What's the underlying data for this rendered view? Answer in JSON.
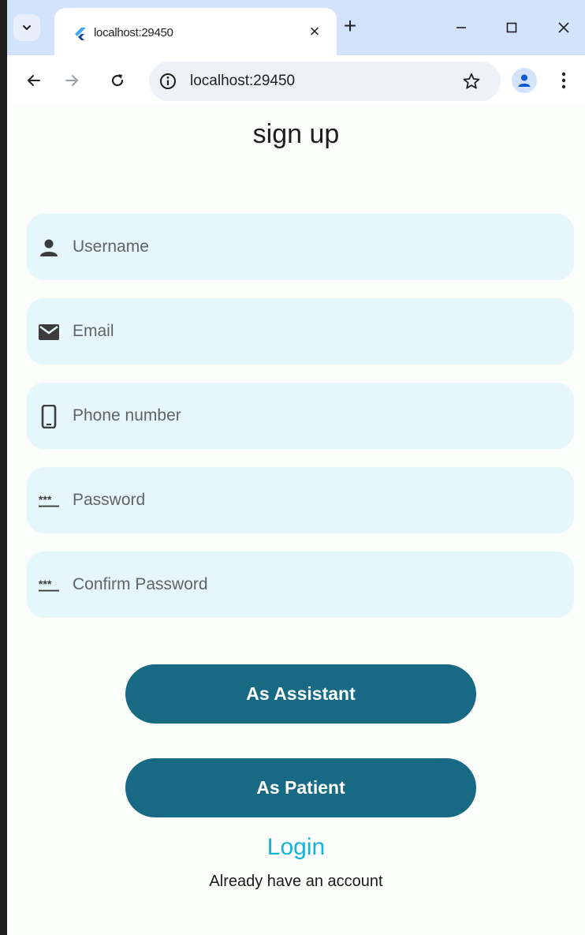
{
  "browser": {
    "tab_title": "localhost:29450",
    "url": "localhost:29450",
    "tab_close_glyph": "×",
    "new_tab_glyph": "+"
  },
  "page": {
    "title": "sign up",
    "fields": [
      {
        "icon": "person-icon",
        "placeholder": "Username",
        "value": ""
      },
      {
        "icon": "mail-icon",
        "placeholder": "Email",
        "value": ""
      },
      {
        "icon": "phone-icon",
        "placeholder": "Phone number",
        "value": ""
      },
      {
        "icon": "password-icon",
        "placeholder": "Password",
        "value": ""
      },
      {
        "icon": "password-icon",
        "placeholder": "Confirm Password",
        "value": ""
      }
    ],
    "buttons": {
      "assistant": "As Assistant",
      "patient": "As Patient"
    },
    "login_link": "Login",
    "login_subtext": "Already have an account"
  },
  "colors": {
    "primary_button": "#186a84",
    "field_background": "#e5f7fa",
    "link": "#11b3d9",
    "tab_strip": "#d3e3fd"
  }
}
